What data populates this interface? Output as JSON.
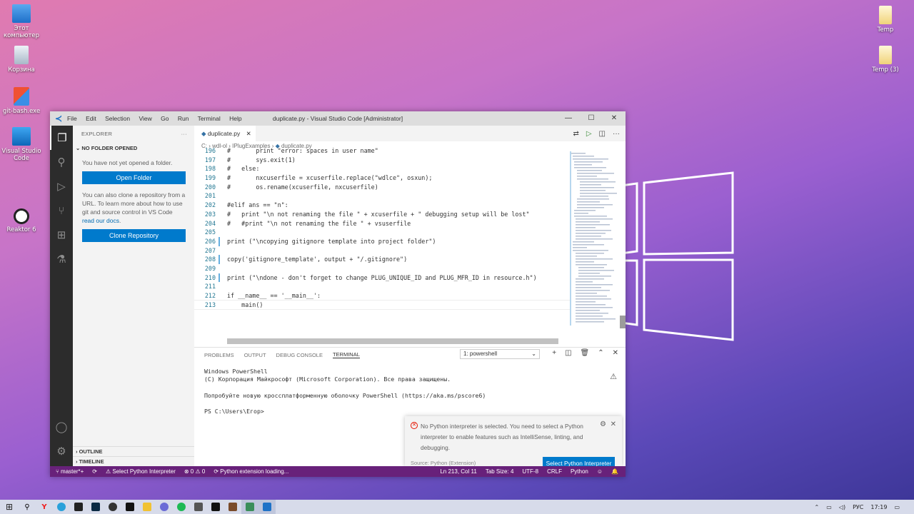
{
  "desktop": {
    "icons_left": [
      {
        "label": "Этот компьютер",
        "icon": "computer-icon"
      },
      {
        "label": "Корзина",
        "icon": "recycle-bin-icon"
      },
      {
        "label": "git-bash.exe",
        "icon": "git-icon"
      },
      {
        "label": "Visual Studio Code",
        "icon": "vscode-icon"
      },
      {
        "label": "Reaktor 6",
        "icon": "reaktor-icon"
      }
    ],
    "icons_right": [
      {
        "label": "Temp",
        "icon": "folder-icon"
      },
      {
        "label": "Temp (3)",
        "icon": "folder-icon"
      }
    ]
  },
  "window": {
    "title": "duplicate.py - Visual Studio Code [Administrator]",
    "menu": [
      "File",
      "Edit",
      "Selection",
      "View",
      "Go",
      "Run",
      "Terminal",
      "Help"
    ]
  },
  "sidebar": {
    "header": "EXPLORER",
    "more": "···",
    "section": "NO FOLDER OPENED",
    "text1": "You have not yet opened a folder.",
    "open_folder": "Open Folder",
    "text2_a": "You can also clone a repository from a URL. To learn more about how to use git and source control in VS Code ",
    "text2_link": "read our docs",
    "text2_b": ".",
    "clone": "Clone Repository",
    "outline": "OUTLINE",
    "timeline": "TIMELINE"
  },
  "editor": {
    "tab": "duplicate.py",
    "breadcrumb": [
      "C:",
      "wdl-ol",
      "IPlugExamples",
      "duplicate.py"
    ],
    "lines": [
      {
        "n": "196",
        "t": "#       print \"error: spaces in user name\"",
        "mod": false
      },
      {
        "n": "197",
        "t": "#       sys.exit(1)",
        "mod": false
      },
      {
        "n": "198",
        "t": "#   else:",
        "mod": false
      },
      {
        "n": "199",
        "t": "#       nxcuserfile = xcuserfile.replace(\"wdlce\", osxun);",
        "mod": false
      },
      {
        "n": "200",
        "t": "#       os.rename(xcuserfile, nxcuserfile)",
        "mod": false
      },
      {
        "n": "201",
        "t": "",
        "mod": false
      },
      {
        "n": "202",
        "t": "#elif ans == \"n\":",
        "mod": false
      },
      {
        "n": "203",
        "t": "#   print \"\\n not renaming the file \" + xcuserfile + \" debugging setup will be lost\"",
        "mod": false
      },
      {
        "n": "204",
        "t": "#   #print \"\\n not renaming the file \" + vsuserfile",
        "mod": false
      },
      {
        "n": "205",
        "t": "",
        "mod": false
      },
      {
        "n": "206",
        "t": "print (\"\\ncopying gitignore template into project folder\")",
        "mod": true
      },
      {
        "n": "207",
        "t": "",
        "mod": false
      },
      {
        "n": "208",
        "t": "copy('gitignore_template', output + \"/.gitignore\")",
        "mod": true
      },
      {
        "n": "209",
        "t": "",
        "mod": false
      },
      {
        "n": "210",
        "t": "print (\"\\ndone - don't forget to change PLUG_UNIQUE_ID and PLUG_MFR_ID in resource.h\")",
        "mod": true
      },
      {
        "n": "211",
        "t": "",
        "mod": false
      },
      {
        "n": "212",
        "t": "if __name__ == '__main__':",
        "mod": false
      },
      {
        "n": "213",
        "t": "    main()",
        "mod": false
      }
    ]
  },
  "panel": {
    "tabs": [
      "PROBLEMS",
      "OUTPUT",
      "DEBUG CONSOLE",
      "TERMINAL"
    ],
    "active_tab": "TERMINAL",
    "terminal_select": "1: powershell",
    "terminal_lines": [
      "Windows PowerShell",
      "(C) Корпорация Майкрософт (Microsoft Corporation). Все права защищены.",
      "",
      "Попробуйте новую кроссплатформенную оболочку PowerShell (https://aka.ms/pscore6)",
      "",
      "PS C:\\Users\\Егор>"
    ]
  },
  "notification": {
    "message": "No Python interpreter is selected. You need to select a Python interpreter to enable features such as IntelliSense, linting, and debugging.",
    "source": "Source: Python (Extension)",
    "button": "Select Python Interpreter"
  },
  "statusbar": {
    "branch": "master*+",
    "sync": "⟳",
    "interpreter": "Select Python Interpreter",
    "problems": "⊗ 0 ⚠ 0",
    "loading": "Python extension loading...",
    "position": "Ln 213, Col 11",
    "tab_size": "Tab Size: 4",
    "encoding": "UTF-8",
    "eol": "CRLF",
    "language": "Python"
  },
  "taskbar": {
    "lang": "РУС",
    "time": "17:19"
  },
  "colors": {
    "statusbar": "#68217a",
    "accent": "#007acc"
  }
}
